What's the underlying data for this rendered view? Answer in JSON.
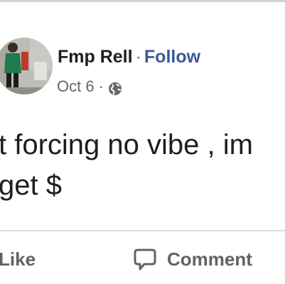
{
  "post": {
    "author": "Fmp Rell",
    "separator": "·",
    "follow_label": "Follow",
    "date": "Oct 6",
    "meta_separator": "·",
    "audience_icon": "globe-icon",
    "text_lines": [
      "t forcing no vibe , im",
      "get $"
    ]
  },
  "actions": {
    "like_label": "Like",
    "comment_label": "Comment",
    "comment_icon": "speech-bubble-icon"
  },
  "colors": {
    "follow_link": "#3b5998",
    "author_text": "#1c1e21",
    "meta_text": "#65676b",
    "action_text": "#5f6368"
  }
}
